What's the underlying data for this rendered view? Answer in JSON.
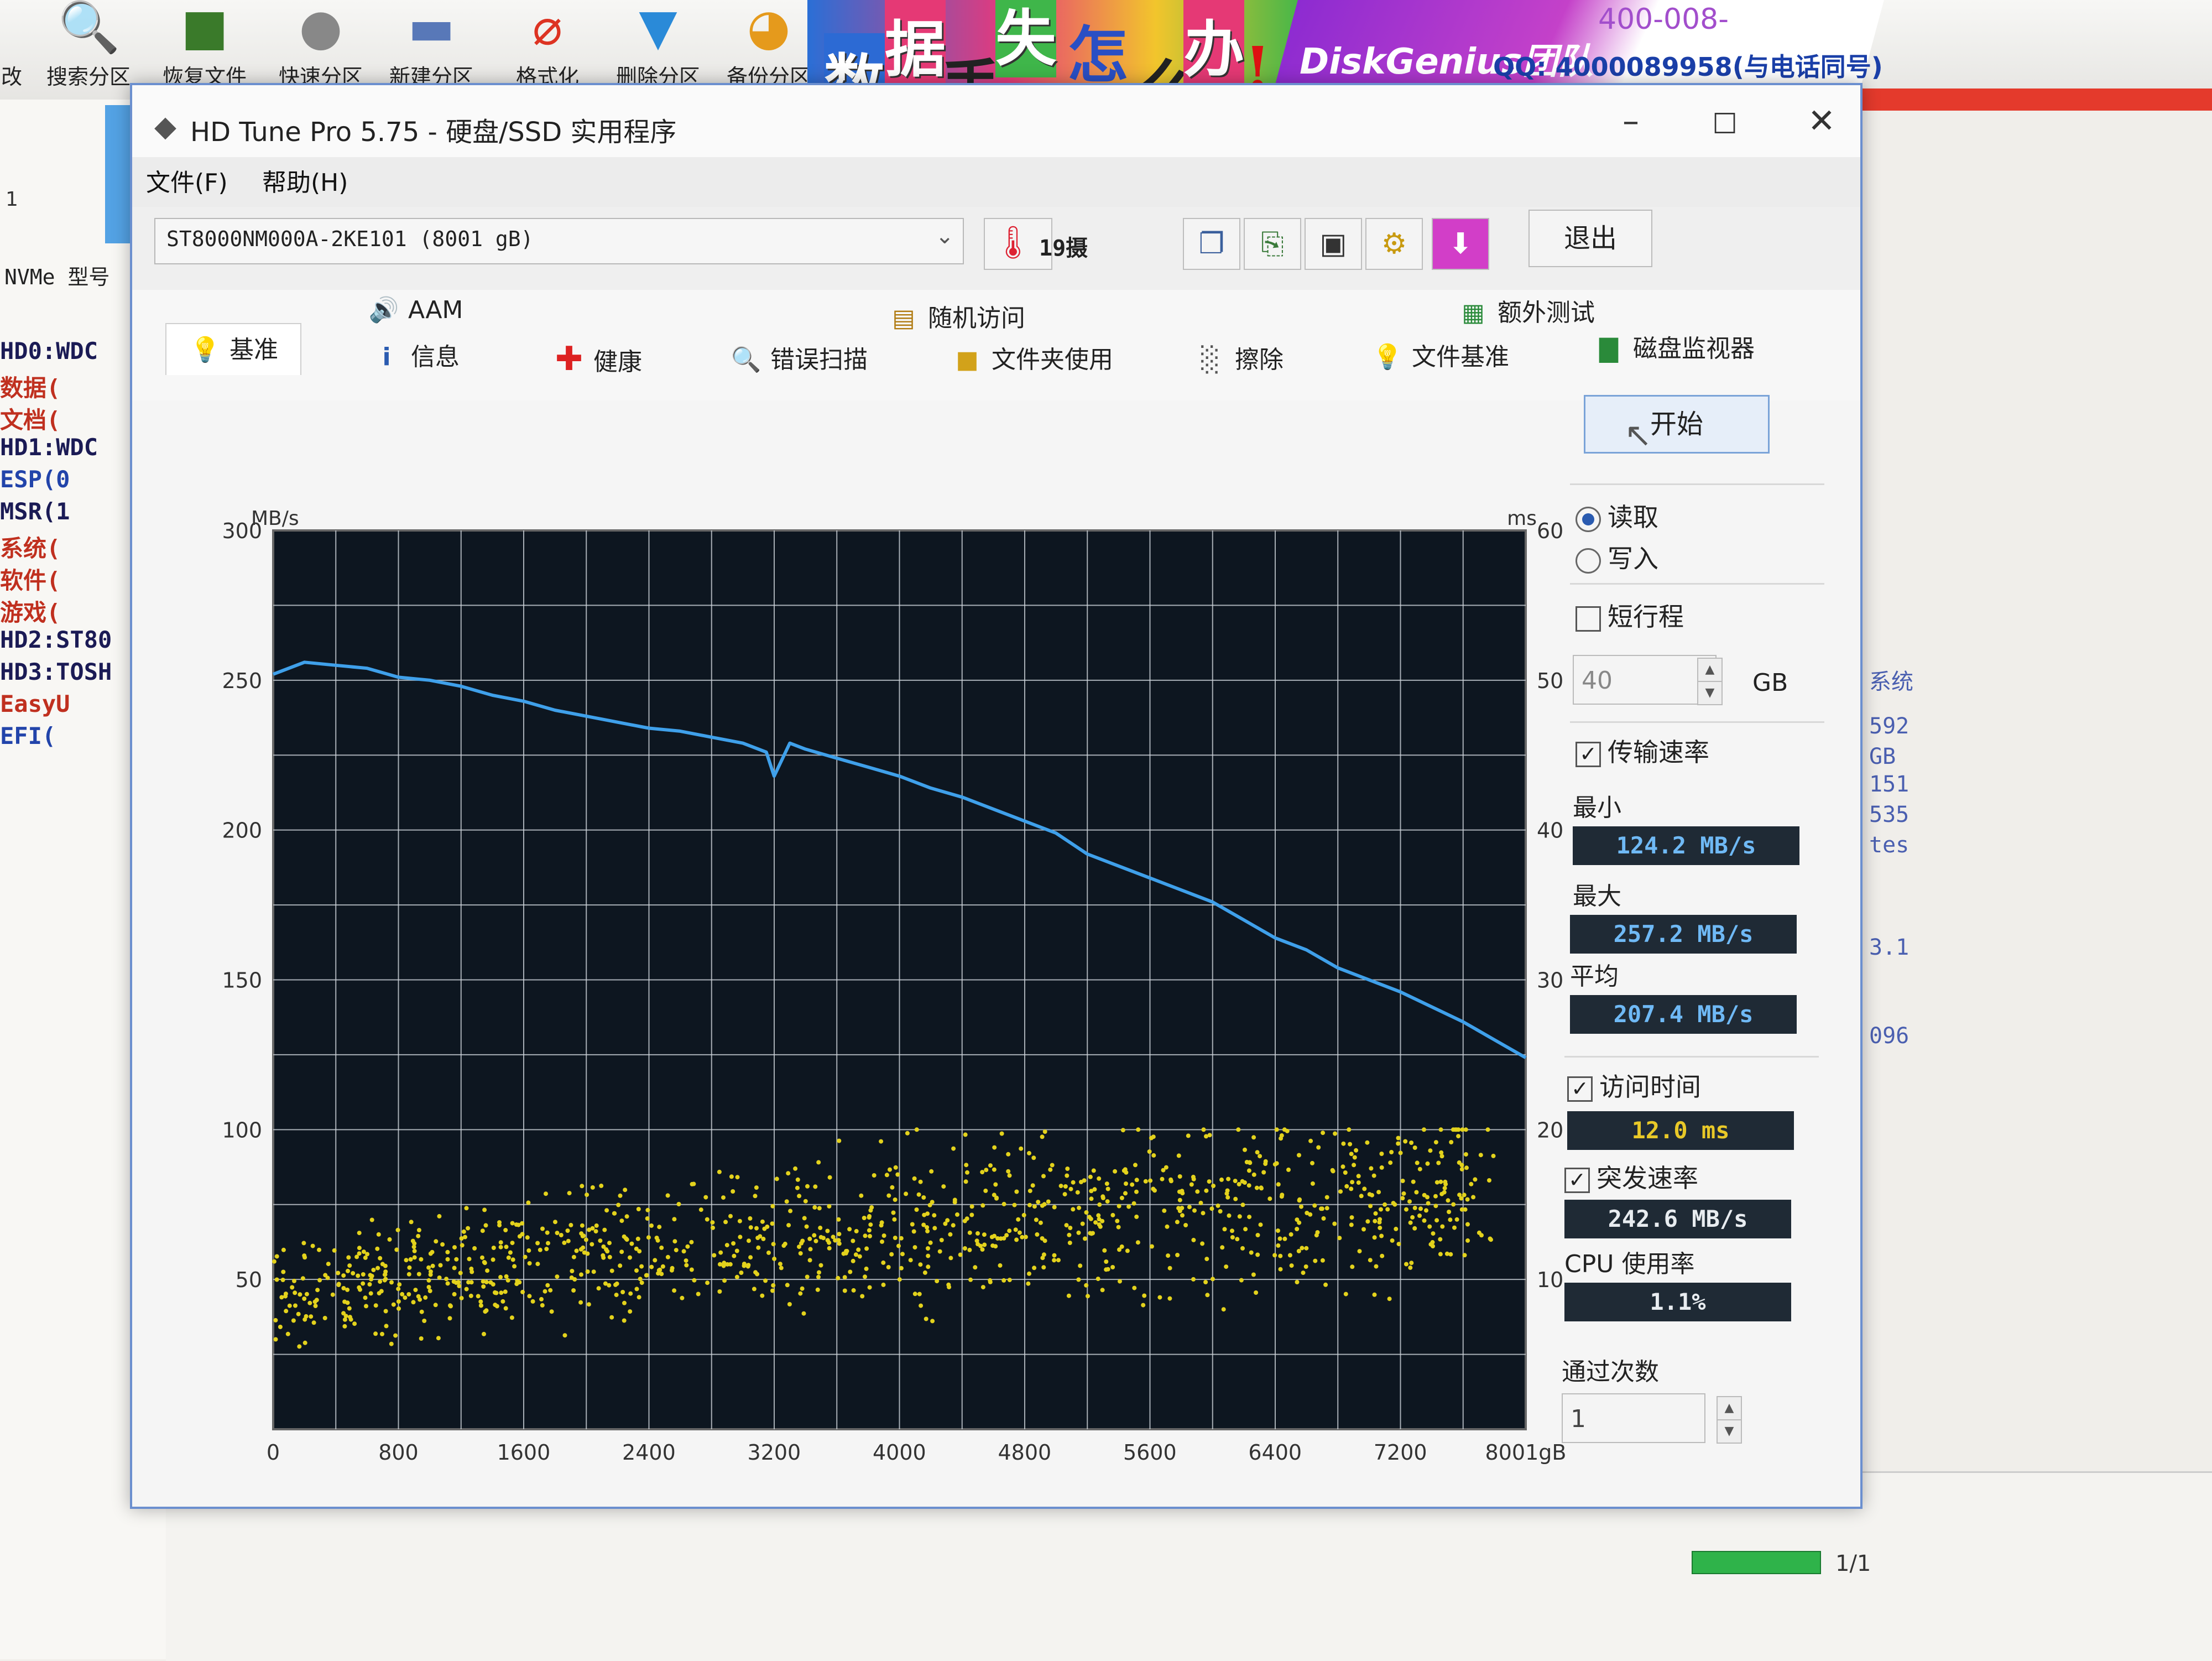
{
  "diskgenius": {
    "toolbar": [
      {
        "icon": "search-icon",
        "label": "搜索分区"
      },
      {
        "icon": "restore-file-icon",
        "label": "恢复文件"
      },
      {
        "icon": "quick-partition-icon",
        "label": "快速分区"
      },
      {
        "icon": "new-partition-icon",
        "label": "新建分区"
      },
      {
        "icon": "format-icon",
        "label": "格式化"
      },
      {
        "icon": "delete-partition-icon",
        "label": "删除分区"
      },
      {
        "icon": "backup-partition-icon",
        "label": "备份分区"
      }
    ],
    "toolbar_fragment": "改",
    "banner_chars": [
      "数",
      "据",
      "丢",
      "失",
      "怎",
      "么",
      "办",
      "!"
    ],
    "promo_title": "DiskGenius团队",
    "promo_qq": "QQ: 4000089958(与电话同号)",
    "promo_tel": "400-008-",
    "left_nvme": "NVMe  型号",
    "left_num": "1",
    "tree": [
      {
        "text": "HD0:WDC",
        "style": "dark"
      },
      {
        "text": "数据(",
        "style": "red"
      },
      {
        "text": "文档(",
        "style": "red"
      },
      {
        "text": "HD1:WDC",
        "style": "dark"
      },
      {
        "text": "ESP(0",
        "style": "blue"
      },
      {
        "text": "MSR(1",
        "style": "dark"
      },
      {
        "text": "系统(",
        "style": "red"
      },
      {
        "text": "软件(",
        "style": "red"
      },
      {
        "text": "游戏(",
        "style": "red"
      },
      {
        "text": "HD2:ST80",
        "style": "dark"
      },
      {
        "text": "HD3:TOSH",
        "style": "dark"
      },
      {
        "text": "EasyU",
        "style": "red"
      },
      {
        "text": "EFI(",
        "style": "blue"
      }
    ],
    "right_info": [
      "系统",
      "592",
      "GB",
      "151",
      "535",
      "tes",
      "3.1",
      "096"
    ]
  },
  "app": {
    "title": "HD Tune Pro 5.75 - 硬盘/SSD 实用程序",
    "menu": [
      "文件(F)",
      "帮助(H)"
    ],
    "drive": "ST8000NM000A-2KE101 (8001 gB)",
    "temperature": "19摄",
    "exit_label": "退出",
    "tabs_top": [
      {
        "icon": "speaker-icon",
        "label": "AAM"
      },
      {
        "icon": "random-access-icon",
        "label": "随机访问"
      },
      {
        "icon": "extra-tests-icon",
        "label": "额外测试"
      }
    ],
    "tabs_bottom": [
      {
        "icon": "benchmark-icon",
        "label": "基准"
      },
      {
        "icon": "info-icon",
        "label": "信息"
      },
      {
        "icon": "health-icon",
        "label": "健康"
      },
      {
        "icon": "error-scan-icon",
        "label": "错误扫描"
      },
      {
        "icon": "folder-usage-icon",
        "label": "文件夹使用"
      },
      {
        "icon": "erase-icon",
        "label": "擦除"
      },
      {
        "icon": "file-benchmark-icon",
        "label": "文件基准"
      },
      {
        "icon": "disk-monitor-icon",
        "label": "磁盘监视器"
      }
    ],
    "panel": {
      "start": "开始",
      "read": "读取",
      "write": "写入",
      "mode_selected": "read",
      "short_stroke": "短行程",
      "short_stroke_checked": false,
      "short_value": "40",
      "short_unit": "GB",
      "transfer_rate": "传输速率",
      "transfer_checked": true,
      "min_label": "最小",
      "min_value": "124.2 MB/s",
      "max_label": "最大",
      "max_value": "257.2 MB/s",
      "avg_label": "平均",
      "avg_value": "207.4 MB/s",
      "access_time": "访问时间",
      "access_checked": true,
      "access_value": "12.0 ms",
      "burst_rate": "突发速率",
      "burst_checked": true,
      "burst_value": "242.6 MB/s",
      "cpu_label": "CPU 使用率",
      "cpu_value": "1.1%",
      "passes_label": "通过次数",
      "passes_value": "1",
      "progress_fraction": 1.0,
      "progress_text": "1/1"
    },
    "colors": {
      "chart_bg": "#0d1620",
      "grid": "#cfd6dc",
      "transfer_line": "#3fa0ea",
      "access_points": "#e3d21c"
    }
  },
  "chart_data": {
    "type": "line",
    "ylabel": "MB/s",
    "y2label": "ms",
    "xlabel": "",
    "x_unit_label": "8001gB",
    "xlim": [
      0,
      8001
    ],
    "ylim": [
      0,
      300
    ],
    "y2lim": [
      0,
      60
    ],
    "x_ticks": [
      "0",
      "800",
      "1600",
      "2400",
      "3200",
      "4000",
      "4800",
      "5600",
      "6400",
      "7200",
      "8001gB"
    ],
    "y_ticks": [
      50,
      100,
      150,
      200,
      250,
      300
    ],
    "y2_ticks": [
      10,
      20,
      30,
      40,
      50,
      60
    ],
    "grid": true,
    "series": [
      {
        "type": "line",
        "x": [
          0,
          200,
          400,
          600,
          800,
          1000,
          1200,
          1400,
          1600,
          1800,
          2000,
          2200,
          2400,
          2600,
          2800,
          3000,
          3150,
          3200,
          3300,
          3400,
          3600,
          3800,
          4000,
          4200,
          4400,
          4600,
          4800,
          5000,
          5200,
          5400,
          5600,
          5800,
          6000,
          6200,
          6400,
          6600,
          6800,
          7000,
          7200,
          7400,
          7600,
          7800,
          8001
        ],
        "y": [
          252,
          256,
          255,
          254,
          251,
          250,
          248,
          245,
          243,
          240,
          238,
          236,
          234,
          233,
          231,
          229,
          226,
          218,
          229,
          227,
          224,
          221,
          218,
          214,
          211,
          207,
          203,
          199,
          192,
          188,
          184,
          180,
          176,
          170,
          164,
          160,
          154,
          150,
          146,
          141,
          136,
          130,
          124
        ]
      },
      {
        "type": "scatter",
        "y_axis": "right",
        "x_range": [
          0,
          7800
        ],
        "y_range_ms": [
          4,
          20
        ],
        "trend_ms": [
          [
            0,
            9
          ],
          [
            1600,
            11
          ],
          [
            4000,
            13.5
          ],
          [
            8001,
            16
          ]
        ]
      }
    ]
  }
}
